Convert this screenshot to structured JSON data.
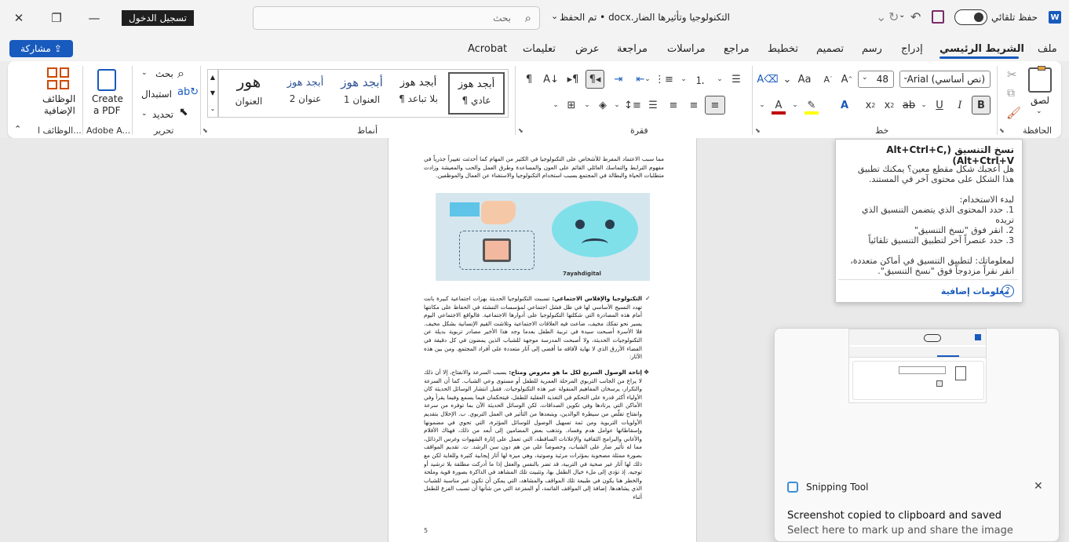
{
  "window": {
    "doc_title": "التكنولوجيا وتأثيرها الضار.docx • تم الحفظ",
    "search_placeholder": "بحث",
    "autosave_label": "حفظ تلقائي",
    "sign_in": "تسجيل الدخول",
    "share": "مشاركة"
  },
  "tabs": [
    "ملف",
    "الشريط الرئيسي",
    "إدراج",
    "رسم",
    "تصميم",
    "تخطيط",
    "مراجع",
    "مراسلات",
    "مراجعة",
    "عرض",
    "تعليمات",
    "Acrobat"
  ],
  "ribbon": {
    "clipboard": {
      "paste": "لصق",
      "label": "الحافظة"
    },
    "font": {
      "name": "Arial (نص أساسي)",
      "size": "48",
      "label": "خط"
    },
    "paragraph": {
      "label": "فقرة"
    },
    "styles": {
      "label": "أنماط",
      "items": [
        {
          "preview": "أبجد هوز",
          "name": "¶ عادي"
        },
        {
          "preview": "أبجد هوز",
          "name": "¶ بلا تباعد"
        },
        {
          "preview": "أبجد هوز",
          "name": "العنوان 1"
        },
        {
          "preview": "أبجد هوز",
          "name": "عنوان 2"
        },
        {
          "preview": "هور",
          "name": "العنوان"
        }
      ]
    },
    "editing": {
      "find": "بحث",
      "replace": "استبدال",
      "select": "تحديد",
      "label": "تحرير"
    },
    "acrobat": {
      "create_pdf_1": "Create",
      "create_pdf_2": "a PDF",
      "label": "Adobe A..."
    },
    "addins": {
      "line1": "الوظائف",
      "line2": "الإضافية",
      "label": "الوظائف ا..."
    }
  },
  "document": {
    "p1": "مما سبب الاعتماد المفرط للأشخاص على التكنولوجيا في الكثير من المهام كما أحدثت تغييراً جذرياً في مفهوم الترابط والتماسك العائلي القائم على العون والمساعدة وطرق العمل والحب والمعيشة وزادت متطلبات الحياة والبطالة في المجتمع بسبب استخدام التكنولوجيا والاستغناء عن العمال والموظفين.",
    "img_caption": "7ayahdigital",
    "p2_head": "التكنولوجيا والإفلاس الاجتماعي:",
    "p2": "تسببت التكنولوجيا الحديثة بهزات اجتماعية كبيرة بانت تهدد النسيج الأساسي لها في ظل فشل اجتماعي لمؤسسات التنشئة في الحفاظ على مكانتها أمام هذه المصادرة التي شكلتها التكنولوجيا على أدوارها الاجتماعية. فالواقع الاجتماعي اليوم يسير نحو تفكك مخيف، ضاعت فيه العلاقات الاجتماعية وتلاشت القيم الإنسانية بشكل مخيف. فلا الأسرة أصبحت سيدة في تربية الطفل بعدما وجد هذا الأخير مصادر تربوية بديلة عن التكنولوجيات الحديثة، ولا أصبحت المدرسة موجهة للشباب الذين يمضون في كل دقيقة في الفضاء الأزرق الذي لا نهاية لآفاقه ما أفضى إلى آثار متعددة على أفراد المجتمع. ومن بين هذه الآثار:",
    "p3_head": "إتاحة الوصول السريع لكل ما هو معروض ومتاح:",
    "p3": "بسبب السرعة والانفتاح، إلا أن ذلك لا يراع من الجانب التربوي المرحلة العمرية للطفل أو مستوى وعي الشباب. كما أن السرعة والتكرار، يرسخان المفاهيم المنقولة عبر هذه التكنولوجيات. فقبل انتشار الوسائل الحديثة كان الأولياء أكثر قدرة على التحكم في التغذية العقلية للطفل، فيتحكمان فيما يسمع وفيما يقرأ وفي الأماكن التي يرتادها وفي تكوين الصداقات. لكن الوسائل الحديثة الآن بما توفره من سرعة وانفتاح تقلّص من سيطرة الوالدين، ويتبعدها من التأثير في العمل التربوي. ب. الإخلال بتقديم الأولويات التربوية ومن ثمة تسهيل الوصول للوسائل المؤثرة، التي تحوي في مضمونها وإسقاطاتها عوامل هدم وفساد. وتذهب بعض المضامين إلى أبعد من ذلك، فهناك الأفلام والأغاني والبرامج الثقافية والإعلانات الساقطة، التي تعمل على إثارة الشهوات وغرس الرذائل، مما له تأثير ضار على الشباب، وخصوصاً على من هم دون سن الرشد. ت. تقديم المواقف بصورة ممثلة مصحوبة بمؤثرات مرئية وصوتية، وهي ميزة لها آثار إيجابية كثيرة وللغاية لكن مع ذلك لها آثار غير صحية في التربية، قد تضر بالنفس والعقل إذا ما أدركت مطلقة بلا ترشيد أو توجيه. إذ تؤدي إلى ملء خيال الطفل بها، وتثبيت تلك المشاهد في الذاكرة بصورة قوية وملحة والخطر هنا يكون في طبيعة تلك المواقف والمشاهد، التي يمكن أن تكون غير مناسبة للشباب الذي يشاهدها. إضافة إلى المواقف القاتمة، أو المفزعة التي من شأنها أن تسبب الفزع للطفل أثناء",
    "page_num": "5"
  },
  "tooltip": {
    "title": "نسخ التنسيق (Alt+Ctrl+C, Alt+Ctrl+V)",
    "l1": "هل أعجبك شكل مقطع معين؟ يمكنك تطبيق",
    "l2": "هذا الشكل على محتوى آخر في المستند.",
    "l3": "لبدء الاستخدام:",
    "l4": "1. حدد المحتوى الذي يتضمن التنسيق الذي",
    "l5": "تريده",
    "l6": "2. انقر فوق \"نسخ التنسيق\"",
    "l7": "3. حدد عنصراً آخر لتطبيق التنسيق تلقائياً",
    "l8": "لمعلوماتك: لتطبيق التنسيق في أماكن متعددة،",
    "l9": "انقر نقراً مزدوجاً فوق \"نسخ التنسيق\".",
    "more": "معلومات إضافية"
  },
  "snipping": {
    "app": "Snipping Tool",
    "heading": "Screenshot copied to clipboard and saved",
    "sub": "Select here to mark up and share the image"
  },
  "colors": {
    "accent": "#185abd",
    "font_red": "#c00000",
    "highlight": "#ffff00"
  }
}
